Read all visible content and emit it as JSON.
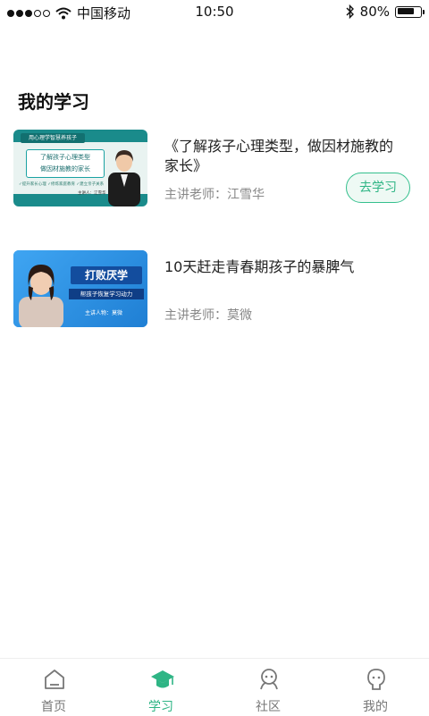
{
  "status_bar": {
    "carrier": "中国移动",
    "time": "10:50",
    "battery_percent": "80%",
    "battery_level": 0.8
  },
  "page": {
    "title": "我的学习"
  },
  "courses": [
    {
      "title": "《了解孩子心理类型，做因材施教的家长》",
      "teacher": "主讲老师：江雪华",
      "action_label": "去学习",
      "thumb": {
        "banner": "用心理学智慧养孩子",
        "line1": "了解孩子心理类型",
        "line2": "做因材施教的家长",
        "speaker": "主讲人：江雪华",
        "ticks": "✓提升家长心理 ✓修炼家庭教育 ✓建立亲子关系"
      }
    },
    {
      "title": "10天赶走青春期孩子的暴脾气",
      "teacher": "主讲老师：莫微",
      "thumb": {
        "headline": "打败厌学",
        "subline": "帮孩子恢复学习动力",
        "host": "主讲人物：莫微"
      }
    }
  ],
  "tabs": [
    {
      "label": "首页",
      "icon": "home-icon"
    },
    {
      "label": "学习",
      "icon": "graduation-cap-icon",
      "active": true
    },
    {
      "label": "社区",
      "icon": "community-icon"
    },
    {
      "label": "我的",
      "icon": "profile-icon"
    }
  ],
  "colors": {
    "accent": "#2fb585",
    "inactive": "#777777"
  }
}
